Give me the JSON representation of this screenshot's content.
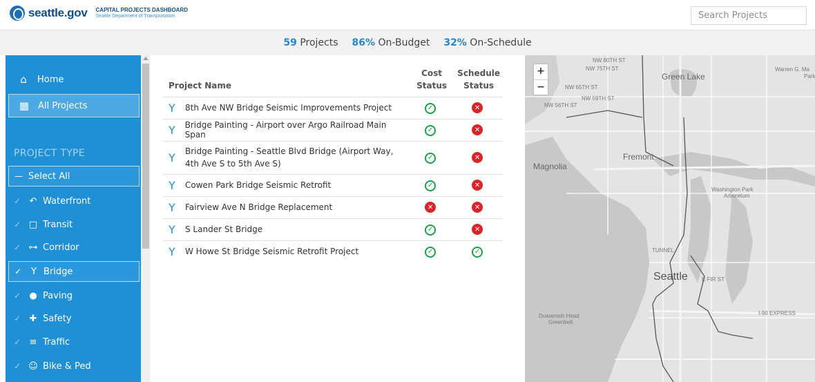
{
  "header": {
    "logo_text": "seattle.gov",
    "dashboard_title": "CAPITAL PROJECTS DASHBOARD",
    "dashboard_subtitle": "Seattle Department of Transportation",
    "search_placeholder": "Search Projects"
  },
  "stats": {
    "projects_num": "59",
    "projects_label": "Projects",
    "budget_num": "86%",
    "budget_label": "On-Budget",
    "schedule_num": "32%",
    "schedule_label": "On-Schedule"
  },
  "sidebar": {
    "home_label": "Home",
    "all_projects_label": "All Projects",
    "section_label": "PROJECT TYPE",
    "select_all_label": "Select All",
    "types": [
      {
        "label": "Waterfront",
        "icon": "waterfront-icon",
        "selected": false
      },
      {
        "label": "Transit",
        "icon": "transit-icon",
        "selected": false
      },
      {
        "label": "Corridor",
        "icon": "corridor-icon",
        "selected": false
      },
      {
        "label": "Bridge",
        "icon": "bridge-icon",
        "selected": true
      },
      {
        "label": "Paving",
        "icon": "paving-icon",
        "selected": false
      },
      {
        "label": "Safety",
        "icon": "safety-icon",
        "selected": false
      },
      {
        "label": "Traffic",
        "icon": "traffic-icon",
        "selected": false
      },
      {
        "label": "Bike & Ped",
        "icon": "bike-ped-icon",
        "selected": false
      }
    ]
  },
  "table": {
    "headers": {
      "name": "Project Name",
      "cost": "Cost Status",
      "schedule_line1": "Schedule",
      "schedule_line2": "Status"
    },
    "rows": [
      {
        "name": "8th Ave NW Bridge Seismic Improvements Project",
        "cost": "ok",
        "schedule": "bad"
      },
      {
        "name": "Bridge Painting - Airport over Argo Railroad Main Span",
        "cost": "ok",
        "schedule": "bad"
      },
      {
        "name": "Bridge Painting - Seattle Blvd Bridge (Airport Way, 4th Ave S to 5th Ave S)",
        "cost": "ok",
        "schedule": "bad"
      },
      {
        "name": "Cowen Park Bridge Seismic Retrofit",
        "cost": "ok",
        "schedule": "bad"
      },
      {
        "name": "Fairview Ave N Bridge Replacement",
        "cost": "bad",
        "schedule": "bad"
      },
      {
        "name": "S Lander St Bridge",
        "cost": "ok",
        "schedule": "bad"
      },
      {
        "name": "W Howe St Bridge Seismic Retrofit Project",
        "cost": "ok",
        "schedule": "ok"
      }
    ]
  },
  "map": {
    "zoom_in": "+",
    "zoom_out": "−",
    "labels": {
      "green_lake": "Green Lake",
      "fremont": "Fremont",
      "magnolia": "Magnolia",
      "seattle": "Seattle",
      "washington_park": "Washington Park",
      "arboretum": "Arboretum",
      "nw80": "NW 80TH ST",
      "nw75": "NW 75TH ST",
      "nw65": "NW 65TH ST",
      "nw59": "NW 59TH ST",
      "nw56": "NW 56TH ST",
      "efir": "E FIR ST",
      "i90": "I-90 EXPRESS",
      "duwamish": "Duwamish Head",
      "greenbelt": "Greenbelt",
      "tunnel": "TUNNEL",
      "warren": "Warren G. Ma",
      "park": "Park"
    }
  }
}
